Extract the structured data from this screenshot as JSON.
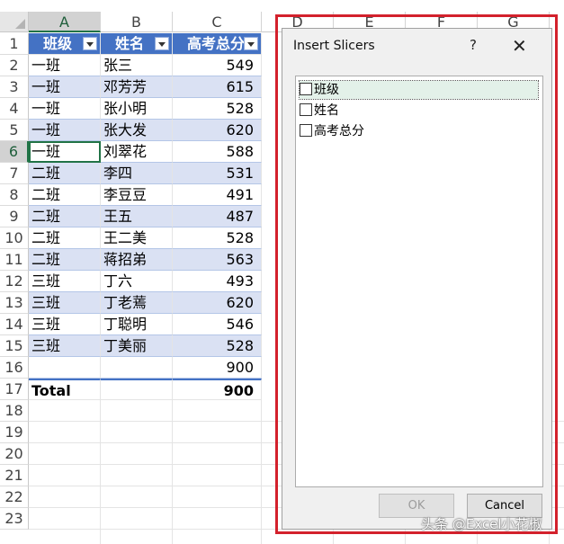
{
  "columns": [
    "A",
    "B",
    "C",
    "D",
    "E",
    "F",
    "G"
  ],
  "active_column": "A",
  "active_row": 6,
  "row_numbers": [
    1,
    2,
    3,
    4,
    5,
    6,
    7,
    8,
    9,
    10,
    11,
    12,
    13,
    14,
    15,
    16,
    17,
    18,
    19,
    20,
    21,
    22,
    23
  ],
  "table": {
    "headers": [
      "班级",
      "姓名",
      "高考总分"
    ],
    "rows": [
      [
        "一班",
        "张三",
        "549"
      ],
      [
        "一班",
        "邓芳芳",
        "615"
      ],
      [
        "一班",
        "张小明",
        "528"
      ],
      [
        "一班",
        "张大发",
        "620"
      ],
      [
        "一班",
        "刘翠花",
        "588"
      ],
      [
        "二班",
        "李四",
        "531"
      ],
      [
        "二班",
        "李豆豆",
        "491"
      ],
      [
        "二班",
        "王五",
        "487"
      ],
      [
        "二班",
        "王二美",
        "528"
      ],
      [
        "二班",
        "蒋招弟",
        "563"
      ],
      [
        "三班",
        "丁六",
        "493"
      ],
      [
        "三班",
        "丁老蔫",
        "620"
      ],
      [
        "三班",
        "丁聪明",
        "546"
      ],
      [
        "三班",
        "丁美丽",
        "528"
      ],
      [
        "",
        "",
        "900"
      ]
    ],
    "total_label": "Total",
    "total_value": "900"
  },
  "dialog": {
    "title": "Insert Slicers",
    "help_label": "?",
    "close_label": "✕",
    "fields": [
      "班级",
      "姓名",
      "高考总分"
    ],
    "ok_label": "OK",
    "cancel_label": "Cancel"
  },
  "watermark": "头条 @Excel小花椒",
  "colors": {
    "header_blue": "#4472c4",
    "band_blue": "#dae1f3",
    "selection_green": "#217346",
    "highlight_red": "#d3212c"
  }
}
